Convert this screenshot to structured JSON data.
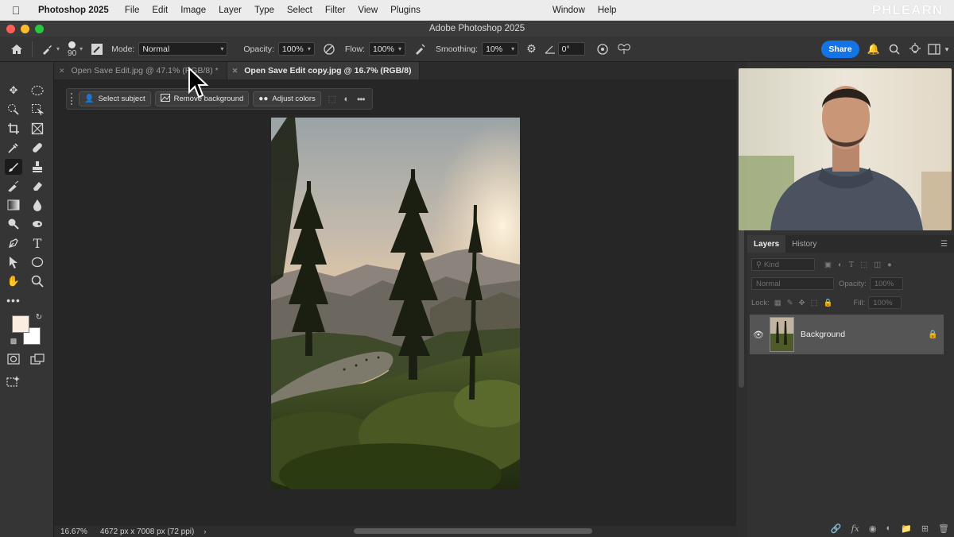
{
  "menubar": {
    "app_name": "Photoshop 2025",
    "items": [
      "File",
      "Edit",
      "Image",
      "Layer",
      "Type",
      "Select",
      "Filter",
      "View",
      "Plugins"
    ],
    "right_items": [
      "Window",
      "Help"
    ],
    "watermark": "PHLEARN"
  },
  "window": {
    "title": "Adobe Photoshop 2025"
  },
  "options": {
    "brush_size": "90",
    "mode_label": "Mode:",
    "mode_value": "Normal",
    "opacity_label": "Opacity:",
    "opacity_value": "100%",
    "flow_label": "Flow:",
    "flow_value": "100%",
    "smoothing_label": "Smoothing:",
    "smoothing_value": "10%",
    "angle_value": "0°",
    "share_label": "Share"
  },
  "tabs": [
    {
      "label": "Open Save Edit.jpg @ 47.1% (RGB/8) *",
      "active": false
    },
    {
      "label": "Open Save Edit copy.jpg @ 16.7% (RGB/8)",
      "active": true
    }
  ],
  "contextbar": {
    "select_subject": "Select subject",
    "remove_background": "Remove background",
    "adjust_colors": "Adjust colors"
  },
  "status": {
    "zoom": "16.67%",
    "doc_info": "4672 px x 7008 px (72 ppi)"
  },
  "panels": {
    "layers_tab": "Layers",
    "history_tab": "History",
    "kind_placeholder": "Kind",
    "blend_mode": "Normal",
    "opacity_label": "Opacity:",
    "opacity_value": "100%",
    "lock_label": "Lock:",
    "fill_label": "Fill:",
    "fill_value": "100%",
    "layer_name": "Background"
  },
  "colors": {
    "accent": "#1473e6",
    "foreground_swatch": "#fbeee0",
    "background_swatch": "#ffffff"
  }
}
